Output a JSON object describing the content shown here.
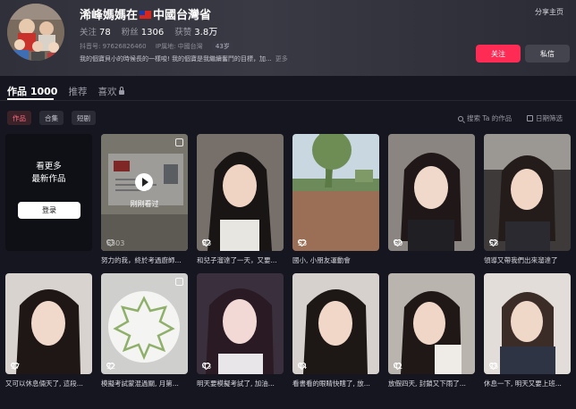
{
  "profile": {
    "nickname": "浠峰媽媽在",
    "nickname_suffix": "中國台灣省",
    "stats": {
      "following_label": "关注",
      "following": "78",
      "followers_label": "粉丝",
      "followers": "1306",
      "likes_label": "获赞",
      "likes": "3.8万"
    },
    "douyin_id": "抖音号: 97626826460",
    "ip_location": "IP属地: 中國台灣",
    "age": "43岁",
    "bio": "我的個寶貝小的時候長的一樣唆! 我的個寶是我繼續奮鬥的目標，加...",
    "bio_more": "更多"
  },
  "header": {
    "share_home": "分享主页",
    "follow_button": "关注",
    "message_button": "私信"
  },
  "tabs": [
    {
      "label": "作品 1000"
    },
    {
      "label": "推荐"
    },
    {
      "label": "喜欢"
    }
  ],
  "filters": {
    "chips": [
      {
        "label": "作品"
      },
      {
        "label": "合集"
      },
      {
        "label": "短剧"
      }
    ],
    "search_label": "搜索 Ta 的作品",
    "date_filter": "日期筛选"
  },
  "login_card": {
    "line1": "看更多",
    "line2": "最新作品",
    "login_button": "登录"
  },
  "overlay": {
    "just_watched": "刚刚看过"
  },
  "colors": {
    "accent": "#fe2c55",
    "background": "#15161f"
  },
  "videos": [
    {
      "likes": "6503",
      "caption": "努力的我，終於考過廚師..."
    },
    {
      "likes": "83",
      "caption": "和兒子溜達了一天，又要..."
    },
    {
      "likes": "53",
      "caption": "國小, 小朋友運動會"
    },
    {
      "likes": "60",
      "caption": ""
    },
    {
      "likes": "58",
      "caption": "領導又帶我們出來溜達了"
    },
    {
      "likes": "37",
      "caption": "又可以休息倆天了, 這段..."
    },
    {
      "likes": "32",
      "caption": "模擬考試蒙混過關, 月第..."
    },
    {
      "likes": "43",
      "caption": "明天要模擬考試了, 加油..."
    },
    {
      "likes": "44",
      "caption": "看書看的眼睛快瞎了, 放..."
    },
    {
      "likes": "41",
      "caption": "放假四天, 封鎖又下雨了..."
    },
    {
      "likes": "35",
      "caption": "休息一下, 明天又要上班..."
    }
  ]
}
